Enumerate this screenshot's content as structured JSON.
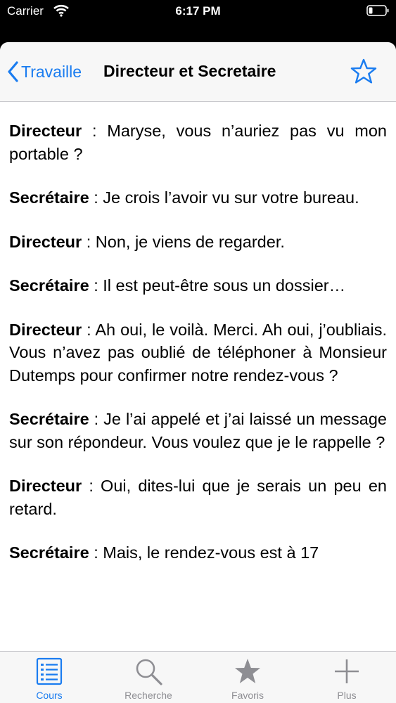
{
  "status": {
    "carrier": "Carrier",
    "time": "6:17 PM"
  },
  "nav": {
    "back_label": "Travaille",
    "title": "Directeur et Secretaire"
  },
  "dialogue": [
    {
      "speaker": "Directeur",
      "text": " : Maryse, vous n’auriez pas vu mon portable ?"
    },
    {
      "speaker": "Secrétaire",
      "text": " : Je crois l’avoir vu sur votre bureau."
    },
    {
      "speaker": "Directeur",
      "text": " : Non, je viens de regarder."
    },
    {
      "speaker": "Secrétaire",
      "text": " : Il est peut-être sous un dossier…"
    },
    {
      "speaker": "Directeur",
      "text": " : Ah oui, le voilà. Merci. Ah oui, j’oubliais. Vous n’avez pas oublié de téléphoner à Monsieur Dutemps pour confirmer notre rendez-vous ?"
    },
    {
      "speaker": "Secrétaire",
      "text": " : Je l’ai appelé et j’ai laissé un message sur son répondeur. Vous voulez  que je le rappelle ?"
    },
    {
      "speaker": "Directeur",
      "text": " : Oui, dites-lui que je serais un peu en retard."
    },
    {
      "speaker": "Secrétaire",
      "text": " : Mais, le rendez-vous est à 17"
    }
  ],
  "tabs": [
    {
      "label": "Cours",
      "icon": "list-icon",
      "active": true
    },
    {
      "label": "Recherche",
      "icon": "search-icon",
      "active": false
    },
    {
      "label": "Favoris",
      "icon": "star-icon",
      "active": false
    },
    {
      "label": "Plus",
      "icon": "plus-icon",
      "active": false
    }
  ],
  "colors": {
    "accent": "#1a7cf0",
    "inactive": "#8e8e93",
    "bar_bg": "#f7f7f7"
  }
}
